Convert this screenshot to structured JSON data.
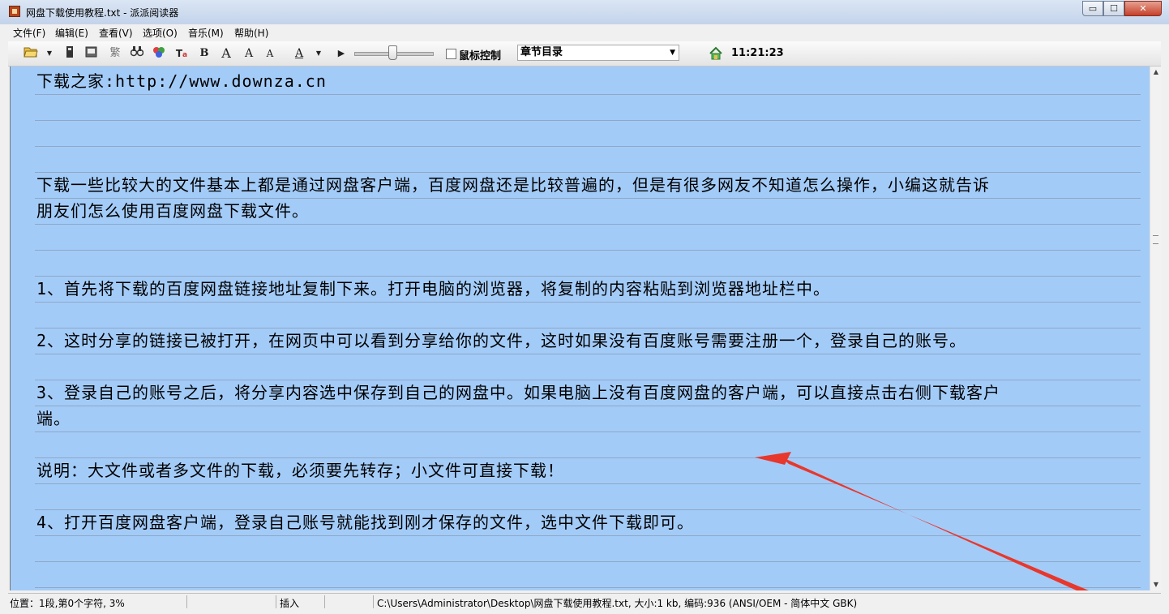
{
  "window": {
    "title": "网盘下载使用教程.txt - 派派阅读器",
    "minimize_glyph": "▭",
    "maximize_glyph": "☐",
    "close_glyph": "✕"
  },
  "menu": [
    "文件(F)",
    "编辑(E)",
    "查看(V)",
    "选项(O)",
    "音乐(M)",
    "帮助(H)"
  ],
  "toolbar": {
    "open_icon": "folder-open-icon",
    "traditional_label": "繁",
    "find_label": "⋔",
    "bold_label": "B",
    "font_a_label": "A",
    "play_glyph": "▶",
    "mouse_control_label": "鼠标控制",
    "chapter_select_value": "章节目录",
    "clock": "11:21:23"
  },
  "content": {
    "lines": [
      "下载之家:http://www.downza.cn",
      "下载一些比较大的文件基本上都是通过网盘客户端，百度网盘还是比较普遍的，但是有很多网友不知道怎么操作，小编这就告诉",
      "朋友们怎么使用百度网盘下载文件。",
      "1、首先将下载的百度网盘链接地址复制下来。打开电脑的浏览器，将复制的内容粘贴到浏览器地址栏中。",
      "2、这时分享的链接已被打开，在网页中可以看到分享给你的文件，这时如果没有百度账号需要注册一个，登录自己的账号。",
      "3、登录自己的账号之后，将分享内容选中保存到自己的网盘中。如果电脑上没有百度网盘的客户端，可以直接点击右侧下载客户",
      "端。",
      "说明：大文件或者多文件的下载，必须要先转存；小文件可直接下载！",
      "4、打开百度网盘客户端，登录自己账号就能找到刚才保存的文件，选中文件下载即可。"
    ],
    "background_color": "#a3cbf8",
    "arrow_color": "#e8372c"
  },
  "status": {
    "position": "位置：1段,第0个字符, 3%",
    "mode": "插入",
    "file_info": "C:\\Users\\Administrator\\Desktop\\网盘下载使用教程.txt, 大小:1 kb, 编码:936   (ANSI/OEM - 简体中文 GBK)"
  }
}
